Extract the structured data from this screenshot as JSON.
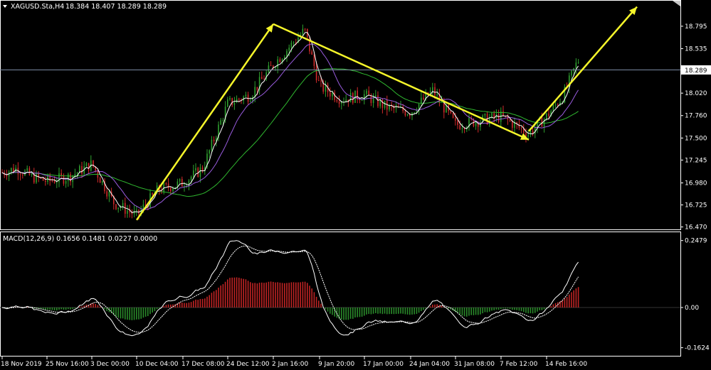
{
  "header": {
    "symbol_label": "XAGUSD.Sta,H4",
    "ohlc_label": "18.384 18.407 18.289 18.289"
  },
  "macd_header": {
    "label": "MACD(12,26,9) 0.1656 0.1481 0.0227 0.0000"
  },
  "current_price_label": "18.289",
  "colors": {
    "background": "#000000",
    "frame": "#ffffff",
    "bull_candle": "#2fa12f",
    "bear_candle": "#d22b2b",
    "ma_fast": "#ffffff",
    "ma_mid": "#9a5ce0",
    "ma_slow": "#2fb62f",
    "arrow": "#f5f52a",
    "hist_pos": "#c02424",
    "hist_neg": "#2a8a2a",
    "signal_line": "#ffffff",
    "price_line": "#7f8ea8"
  },
  "chart_data": [
    {
      "type": "candlestick",
      "price_ticks": [
        "18.795",
        "18.535",
        "18.289",
        "18.020",
        "17.760",
        "17.500",
        "17.245",
        "16.980",
        "16.725",
        "16.470"
      ],
      "ylim": [
        16.45,
        19.0
      ],
      "current_price": 18.289,
      "date_ticks": [
        "18 Nov 2019",
        "25 Nov 16:00",
        "3 Dec 00:00",
        "10 Dec 04:00",
        "17 Dec 08:00",
        "24 Dec 12:00",
        "2 Jan 16:00",
        "9 Jan 20:00",
        "17 Jan 00:00",
        "24 Jan 04:00",
        "31 Jan 08:00",
        "7 Feb 12:00",
        "14 Feb 16:00"
      ],
      "price_anchors": [
        [
          "18 Nov 2019",
          17.1
        ],
        [
          "20 Nov 2019",
          17.15
        ],
        [
          "22 Nov 2019",
          17.05
        ],
        [
          "25 Nov 16:00",
          17.0
        ],
        [
          "28 Nov 2019",
          17.05
        ],
        [
          "3 Dec 00:00",
          17.2
        ],
        [
          "5 Dec 2019",
          16.75
        ],
        [
          "10 Dec 04:00",
          16.6
        ],
        [
          "12 Dec 2019",
          16.9
        ],
        [
          "17 Dec 08:00",
          16.98
        ],
        [
          "19 Dec 2019",
          17.15
        ],
        [
          "24 Dec 12:00",
          17.9
        ],
        [
          "27 Dec 2019",
          18.0
        ],
        [
          "2 Jan 16:00",
          18.35
        ],
        [
          "6 Jan 2020",
          18.75
        ],
        [
          "9 Jan 20:00",
          18.1
        ],
        [
          "13 Jan 2020",
          17.95
        ],
        [
          "17 Jan 00:00",
          18.0
        ],
        [
          "21 Jan 2020",
          17.85
        ],
        [
          "24 Jan 04:00",
          17.8
        ],
        [
          "28 Jan 2020",
          18.05
        ],
        [
          "31 Jan 08:00",
          17.65
        ],
        [
          "4 Feb 2020",
          17.7
        ],
        [
          "7 Feb 12:00",
          17.75
        ],
        [
          "11 Feb 2020",
          17.55
        ],
        [
          "14 Feb 16:00",
          17.75
        ],
        [
          "18 Feb 2020",
          18.0
        ],
        [
          "20 Feb 2020",
          18.4
        ]
      ],
      "arrows": [
        {
          "from": [
            "10 Dec 04:00",
            16.55
          ],
          "to": [
            "2 Jan 16:00",
            18.82
          ]
        },
        {
          "from": [
            "2 Jan 16:00",
            18.82
          ],
          "to": [
            "11 Feb 2020",
            17.48
          ]
        },
        {
          "from": [
            "11 Feb 2020",
            17.58
          ],
          "to": [
            "25 Feb 2020",
            19.02
          ]
        }
      ],
      "legend": "none",
      "grid": false
    },
    {
      "type": "macd",
      "ticks": [
        "0.2479",
        "0.00",
        "-0.1624"
      ],
      "ylim": [
        -0.175,
        0.255
      ],
      "values": {
        "macd": 0.1656,
        "signal": 0.1481,
        "histogram": 0.0227
      }
    }
  ]
}
